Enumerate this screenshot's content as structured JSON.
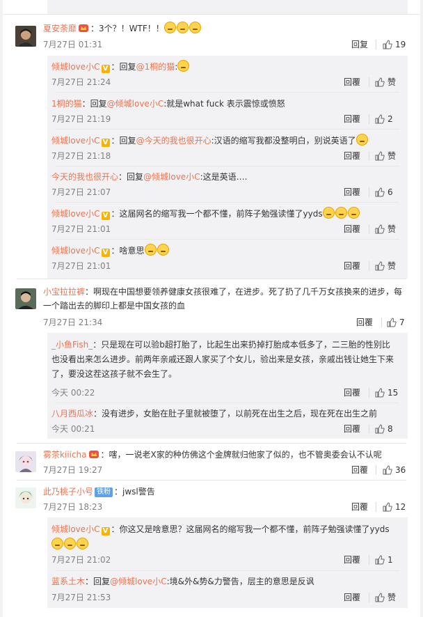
{
  "comments": [
    {
      "author": "夏安荼靡",
      "text": "：3个？！WTF！！",
      "time": "7月27日 01:31",
      "reply": "回复",
      "likes": "19",
      "subs": [
        {
          "author": "倾城love小C",
          "mid": "：回复",
          "mention": "@1桐的猫",
          "text": ":",
          "time": "7月27日 21:24",
          "reply": "回覆",
          "likes": "赞"
        },
        {
          "author": "1桐的猫",
          "mid": "：回复",
          "mention": "@倾城love小C",
          "text": ":就是what fuck 表示震惊或愤怒",
          "time": "7月27日 21:19",
          "reply": "回覆",
          "likes": "2"
        },
        {
          "author": "倾城love小C",
          "mid": "：回复",
          "mention": "@今天的我也很开心",
          "text": ":汉语的缩写我都没整明白，别说英语了",
          "time": "7月27日 21:18",
          "reply": "回覆",
          "likes": "赞"
        },
        {
          "author": "今天的我也很开心",
          "mid": "：回复",
          "mention": "@倾城love小C",
          "text": ":这是英语….",
          "time": "7月27日 21:07",
          "reply": "回覆",
          "likes": "6"
        },
        {
          "author": "倾城love小C",
          "mid": "",
          "mention": "",
          "text": "：这届网名的缩写我一个都不懂，前阵子勉强读懂了yyds",
          "time": "7月27日 21:01",
          "reply": "回覆",
          "likes": "赞"
        },
        {
          "author": "倾城love小C",
          "mid": "",
          "mention": "",
          "text": "：啥意思",
          "time": "7月27日 21:01",
          "reply": "回覆",
          "likes": "赞"
        }
      ]
    },
    {
      "author": "小宝拉拉裤",
      "text_line1": "：啊现在中国想要领养健康女孩很难了，在进步。死了扔了几千万女孩换来的进步，每",
      "text_line2": "一个踏出去的脚印上都是中国女孩的血",
      "time": "7月27日 21:34",
      "reply": "回覆",
      "likes": "7",
      "subs": [
        {
          "author": "_小鱼Fish_",
          "text_line1": "：只是现在可以验b超打胎了，比起生出来扔掉打胎成本低多了，二三胎的性别比",
          "text_line2": "也没看出来怎么进步。前两年亲戚还跟人家买了个女儿，验出来是女孩，亲戚出钱让她生下来",
          "text_line3": "了，要没这茬这孩子就不会生了。",
          "time": "今天 00:22",
          "reply": "回覆",
          "likes": "15"
        },
        {
          "author": "八月西瓜冰",
          "text": "：没有进步，女胎在肚子里就被堕了，以前死在出生之后，现在死在出生之前",
          "time": "今天 00:21",
          "reply": "回覆",
          "likes": "8"
        }
      ]
    },
    {
      "author": "雾茶kiiicha",
      "text": "：嗐，一说老X家的种仿佛这个金牌就归他家了似的，也不管奥委会认不认呢",
      "time": "7月27日 19:27",
      "reply": "回覆",
      "likes": "36"
    },
    {
      "author": "此乃桃子小号",
      "badge": "铁粉",
      "text": "：jwsl警告",
      "time": "7月27日 18:23",
      "reply": "回覆",
      "likes": "12",
      "subs": [
        {
          "author": "倾城love小C",
          "text": "：你这又是啥意思？这届网名的缩写我一个都不懂，前阵子勉强读懂了yyds",
          "time": "7月27日 21:02",
          "reply": "回覆",
          "likes": "1"
        },
        {
          "author": "蓝系土木",
          "mid": "：回复",
          "mention": "@倾城love小C",
          "text": ":境&外&势&力警告，层主的意思是反讽",
          "time": "7月27日 21:53",
          "reply": "回覆",
          "likes": "赞"
        }
      ]
    }
  ],
  "colors": {
    "link": "#eb7350",
    "text": "#333333",
    "meta": "#808080",
    "subbg": "#f2f2f5"
  },
  "icons": {
    "like": "thumbs-up-icon",
    "vip": "v-badge-icon",
    "emoji": "emoji-icon",
    "crown": "crown-badge-icon"
  }
}
